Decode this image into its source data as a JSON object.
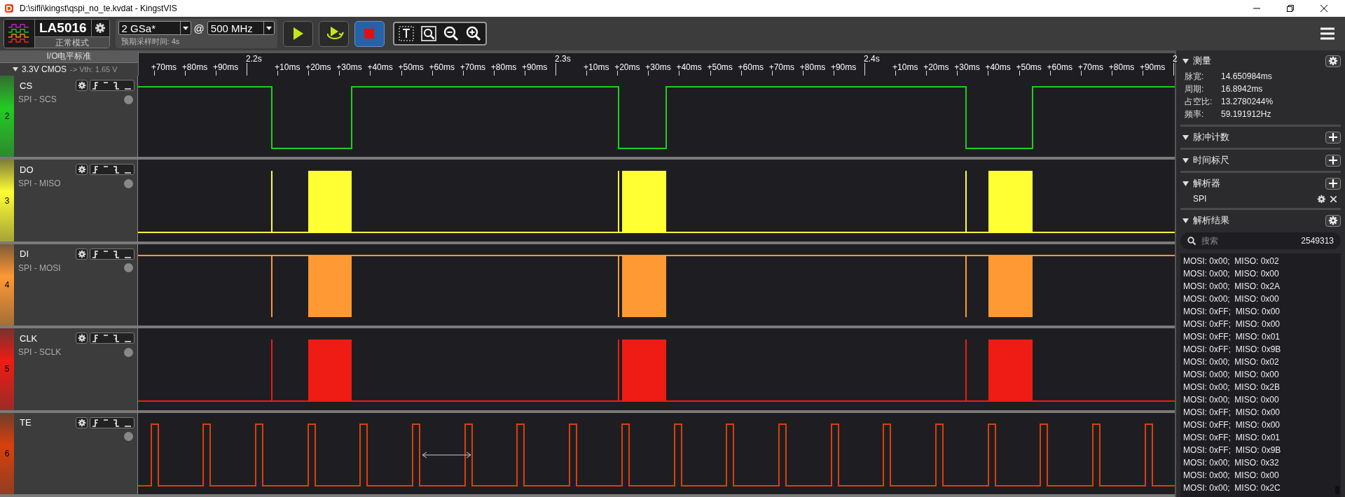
{
  "window": {
    "title": "D:\\sifli\\kingst\\qspi_no_te.kvdat - KingstVIS"
  },
  "device": {
    "model": "LA5016",
    "mode": "正常模式"
  },
  "sampling": {
    "rate": "2 GSa*",
    "at": "@",
    "frequency": "500 MHz",
    "expected_time": "预期采样时间: 4s"
  },
  "capture_buttons": [
    {
      "kind": "start",
      "active": false
    },
    {
      "kind": "loop",
      "active": false
    },
    {
      "kind": "stop",
      "active": true
    }
  ],
  "io_standard": {
    "title": "I/O电平标准",
    "standard": "3.3V CMOS",
    "threshold": "-> Vth: 1.65 V"
  },
  "ruler": {
    "ticks": [
      {
        "label": "+70ms",
        "major": false
      },
      {
        "label": "+80ms",
        "major": false
      },
      {
        "label": "+90ms",
        "major": false
      },
      {
        "label": "2.2s",
        "major": true
      },
      {
        "label": "+10ms",
        "major": false
      },
      {
        "label": "+20ms",
        "major": false
      },
      {
        "label": "+30ms",
        "major": false
      },
      {
        "label": "+40ms",
        "major": false
      },
      {
        "label": "+50ms",
        "major": false
      },
      {
        "label": "+60ms",
        "major": false
      },
      {
        "label": "+70ms",
        "major": false
      },
      {
        "label": "+80ms",
        "major": false
      },
      {
        "label": "+90ms",
        "major": false
      },
      {
        "label": "2.3s",
        "major": true
      },
      {
        "label": "+10ms",
        "major": false
      },
      {
        "label": "+20ms",
        "major": false
      },
      {
        "label": "+30ms",
        "major": false
      },
      {
        "label": "+40ms",
        "major": false
      },
      {
        "label": "+50ms",
        "major": false
      },
      {
        "label": "+60ms",
        "major": false
      },
      {
        "label": "+70ms",
        "major": false
      },
      {
        "label": "+80ms",
        "major": false
      },
      {
        "label": "+90ms",
        "major": false
      },
      {
        "label": "2.4s",
        "major": true
      },
      {
        "label": "+10ms",
        "major": false
      },
      {
        "label": "+20ms",
        "major": false
      },
      {
        "label": "+30ms",
        "major": false
      },
      {
        "label": "+40ms",
        "major": false
      },
      {
        "label": "+50ms",
        "major": false
      },
      {
        "label": "+60ms",
        "major": false
      },
      {
        "label": "+70ms",
        "major": false
      },
      {
        "label": "+80ms",
        "major": false
      },
      {
        "label": "+90ms",
        "major": false
      },
      {
        "label": "2",
        "major": true
      }
    ]
  },
  "channels": [
    {
      "name": "CS",
      "number": "2",
      "protocol": "SPI - SCS",
      "color": "#22cc22",
      "kind": "select"
    },
    {
      "name": "DO",
      "number": "3",
      "protocol": "SPI - MISO",
      "color": "#ffff33",
      "kind": "burst",
      "idle_high": false
    },
    {
      "name": "DI",
      "number": "4",
      "protocol": "SPI - MOSI",
      "color": "#ff9933",
      "kind": "burst",
      "idle_high": true
    },
    {
      "name": "CLK",
      "number": "5",
      "protocol": "SPI - SCLK",
      "color": "#ee1c14",
      "kind": "burst",
      "idle_high": false
    },
    {
      "name": "TE",
      "number": "6",
      "color": "#d8400c",
      "kind": "pulse-train"
    }
  ],
  "panel": {
    "measure": {
      "title": "测量",
      "rows": [
        {
          "label": "脉宽:",
          "value": "14.650984ms"
        },
        {
          "label": "周期:",
          "value": "16.8942ms"
        },
        {
          "label": "占空比:",
          "value": "13.2780244%"
        },
        {
          "label": "频率:",
          "value": "59.191912Hz"
        }
      ]
    },
    "pulse_count": {
      "title": "脉冲计数"
    },
    "time_ruler": {
      "title": "时间标尺"
    },
    "decoder": {
      "title": "解析器",
      "items": [
        {
          "name": "SPI"
        }
      ]
    },
    "results": {
      "title": "解析结果",
      "search": {
        "placeholder": "搜索",
        "count": "2549313"
      },
      "rows": [
        "MOSI: 0x00;  MISO: 0x02",
        "MOSI: 0x00;  MISO: 0x00",
        "MOSI: 0x00;  MISO: 0x2A",
        "MOSI: 0x00;  MISO: 0x00",
        "MOSI: 0xFF;  MISO: 0x00",
        "MOSI: 0xFF;  MISO: 0x00",
        "MOSI: 0xFF;  MISO: 0x01",
        "MOSI: 0xFF;  MISO: 0x9B",
        "MOSI: 0x00;  MISO: 0x02",
        "MOSI: 0x00;  MISO: 0x00",
        "MOSI: 0x00;  MISO: 0x2B",
        "MOSI: 0x00;  MISO: 0x00",
        "MOSI: 0xFF;  MISO: 0x00",
        "MOSI: 0xFF;  MISO: 0x00",
        "MOSI: 0xFF;  MISO: 0x01",
        "MOSI: 0xFF;  MISO: 0x9B",
        "MOSI: 0x00;  MISO: 0x32",
        "MOSI: 0x00;  MISO: 0x00",
        "MOSI: 0x00;  MISO: 0x2C"
      ]
    }
  }
}
